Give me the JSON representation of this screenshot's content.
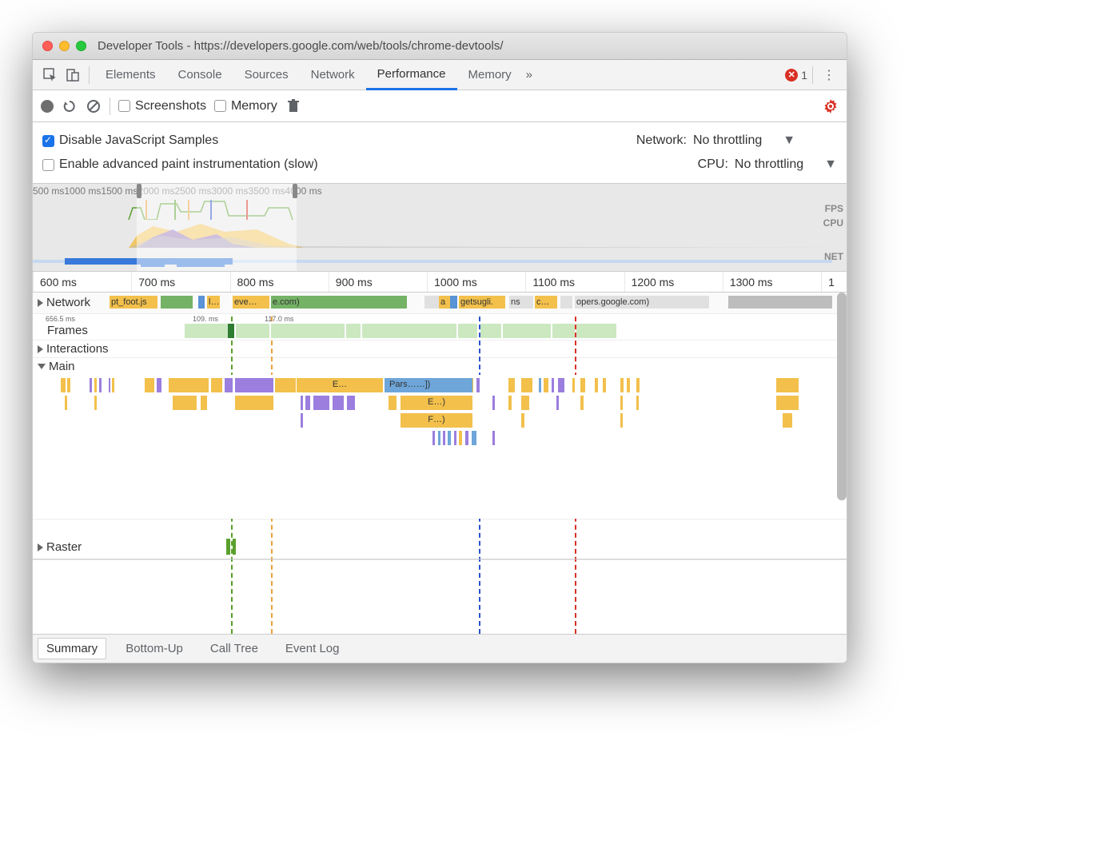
{
  "window": {
    "title": "Developer Tools - https://developers.google.com/web/tools/chrome-devtools/"
  },
  "tabs": {
    "elements": "Elements",
    "console": "Console",
    "sources": "Sources",
    "network": "Network",
    "performance": "Performance",
    "memory": "Memory",
    "more": "»",
    "error_count": "1"
  },
  "toolbar": {
    "screenshots": "Screenshots",
    "memory": "Memory"
  },
  "settings": {
    "disable_js": "Disable JavaScript Samples",
    "advanced_paint": "Enable advanced paint instrumentation (slow)",
    "network_label": "Network:",
    "network_value": "No throttling",
    "cpu_label": "CPU:",
    "cpu_value": "No throttling"
  },
  "overview": {
    "ticks": [
      "500 ms",
      "1000 ms",
      "1500 ms",
      "2000 ms",
      "2500 ms",
      "3000 ms",
      "3500 ms",
      "4000 ms"
    ],
    "labels": {
      "fps": "FPS",
      "cpu": "CPU",
      "net": "NET"
    }
  },
  "ruler": [
    "600 ms",
    "700 ms",
    "800 ms",
    "900 ms",
    "1000 ms",
    "1100 ms",
    "1200 ms",
    "1300 ms",
    "1"
  ],
  "tracks": {
    "network": "Network",
    "frames": "Frames",
    "interactions": "Interactions",
    "main": "Main",
    "raster": "Raster",
    "net_items": {
      "a": "pt_foot.js",
      "b": "l…",
      "c": "eve…",
      "d": "e.com)",
      "e": "a",
      "f": "getsugli.",
      "g": "ns",
      "h": "c…",
      "i": "opers.google.com)"
    },
    "frame_meta": {
      "t0": "656.5 ms",
      "t1": "109.  ms",
      "t2": "117.0 ms"
    },
    "main_items": {
      "e": "E…",
      "pars": "Pars……])",
      "e2": "E…)",
      "f2": "F…)"
    }
  },
  "bottom_tabs": {
    "summary": "Summary",
    "bottomup": "Bottom-Up",
    "calltree": "Call Tree",
    "eventlog": "Event Log"
  },
  "colors": {
    "yellow": "#f2c04b",
    "purple": "#9b7ede",
    "green": "#74b266",
    "lgreen": "#cce8c1",
    "blue": "#6ea6d9",
    "dblue": "#3879d9",
    "gray": "#d4d4d4",
    "orange": "#e8a33d",
    "red": "#e05b4b"
  }
}
